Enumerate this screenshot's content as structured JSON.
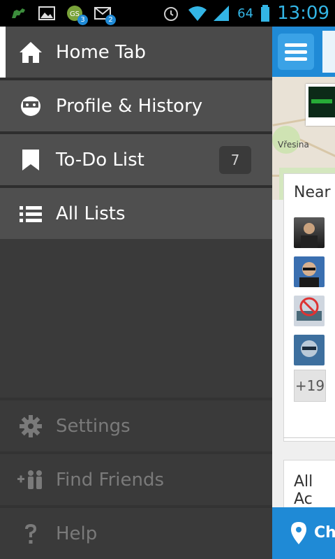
{
  "status_bar": {
    "battery": "64",
    "time": "13:09",
    "notif_badges": [
      "3",
      "2"
    ]
  },
  "drawer": {
    "items": [
      {
        "label": "Home Tab",
        "icon": "home-icon"
      },
      {
        "label": "Profile & History",
        "icon": "profile-icon"
      },
      {
        "label": "To-Do List",
        "icon": "bookmark-icon",
        "count": "7"
      },
      {
        "label": "All Lists",
        "icon": "list-icon"
      }
    ],
    "secondary": [
      {
        "label": "Settings",
        "icon": "gear-icon"
      },
      {
        "label": "Find Friends",
        "icon": "add-friends-icon"
      },
      {
        "label": "Help",
        "icon": "help-icon"
      }
    ]
  },
  "content": {
    "map_label": "Vřesina",
    "nearby_title": "Near",
    "more_count": "+19",
    "activity_title": "All Ac",
    "checkin_label": "Che"
  },
  "colors": {
    "accent": "#1f8ad6",
    "drawer_bg": "#3a3a3a",
    "item_bg": "#4f4f4f"
  }
}
